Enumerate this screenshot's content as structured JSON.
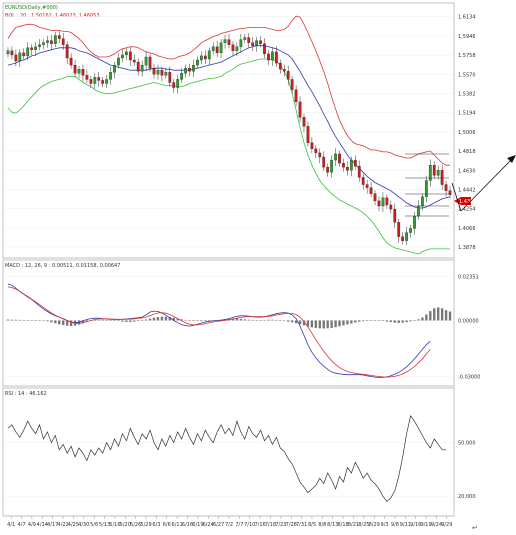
{
  "colors": {
    "up": "#2e9e2e",
    "down": "#d11c1c",
    "ma": "#2b3bb5",
    "band_upper": "#e03434",
    "band_lower": "#3ec03e",
    "macd_line": "#2b3bb5",
    "signal_line": "#e03434",
    "hist": "#777777",
    "rsi": "#333333",
    "price_tag_bg": "#e00000",
    "price_tag_text": "#ffffff",
    "grid": "#cccccc",
    "border": "#999999"
  },
  "header": {
    "title": "EURUSD(Daily,#000)",
    "bollinger": "BOL : 20 : 1.50162, 1.46023, 1.46053",
    "macd": "MACD : 12, 26, 9 : 0.00511, 0.01158, 0.00647",
    "rsi": "RSI : 14 : 46.162"
  },
  "price_tag": "1.4393",
  "chart_data": [
    {
      "type": "candlestick",
      "panel": "price",
      "title": "EURUSD(Daily,#000)",
      "indicator": "BOL : 20 : 1.50162, 1.46023, 1.46053",
      "y_ticks": [
        "1.6134",
        "1.5946",
        "1.5758",
        "1.5570",
        "1.5382",
        "1.5194",
        "1.5006",
        "1.4818",
        "1.4630",
        "1.4442",
        "1.4254",
        "1.4066",
        "1.3878"
      ],
      "ylim": [
        1.38,
        1.62
      ],
      "x_ticks": [
        "4/1",
        "4/7",
        "4/9",
        "4/14",
        "4/17",
        "4/22",
        "4/25",
        "4/30",
        "5/6",
        "5/13",
        "5/16",
        "5/20",
        "5/26",
        "5/29",
        "6/3",
        "6/6",
        "6/11",
        "6/16",
        "6/19",
        "6/24",
        "6/27",
        "7/2",
        "7/7",
        "7/10",
        "7/16",
        "7/18",
        "7/23",
        "7/28",
        "7/31",
        "8/5",
        "8/8",
        "8/13",
        "8/18",
        "8/21",
        "8/25",
        "8/29",
        "9/3",
        "9/8",
        "9/11",
        "9/16",
        "9/19",
        "9/24",
        "9/29"
      ],
      "close": [
        1.58,
        1.576,
        1.57,
        1.578,
        1.575,
        1.583,
        1.581,
        1.584,
        1.586,
        1.588,
        1.59,
        1.587,
        1.595,
        1.592,
        1.586,
        1.573,
        1.566,
        1.558,
        1.562,
        1.556,
        1.552,
        1.548,
        1.554,
        1.551,
        1.548,
        1.552,
        1.559,
        1.566,
        1.573,
        1.576,
        1.579,
        1.571,
        1.569,
        1.56,
        1.566,
        1.574,
        1.563,
        1.557,
        1.561,
        1.556,
        1.559,
        1.549,
        1.544,
        1.552,
        1.558,
        1.563,
        1.56,
        1.566,
        1.571,
        1.575,
        1.572,
        1.58,
        1.584,
        1.578,
        1.588,
        1.591,
        1.586,
        1.58,
        1.584,
        1.591,
        1.593,
        1.588,
        1.585,
        1.59,
        1.587,
        1.577,
        1.571,
        1.579,
        1.568,
        1.562,
        1.56,
        1.552,
        1.542,
        1.53,
        1.515,
        1.506,
        1.49,
        1.484,
        1.48,
        1.476,
        1.466,
        1.461,
        1.473,
        1.479,
        1.47,
        1.466,
        1.463,
        1.473,
        1.467,
        1.456,
        1.449,
        1.446,
        1.44,
        1.433,
        1.428,
        1.436,
        1.429,
        1.425,
        1.412,
        1.398,
        1.394,
        1.402,
        1.406,
        1.418,
        1.428,
        1.437,
        1.453,
        1.468,
        1.458,
        1.463,
        1.449,
        1.443,
        1.439
      ],
      "bb_upper": [
        1.592,
        1.598,
        1.603,
        1.604,
        1.605,
        1.606,
        1.606,
        1.605,
        1.603,
        1.602,
        1.601,
        1.6,
        1.6,
        1.6,
        1.599,
        1.599,
        1.598,
        1.595,
        1.592,
        1.588,
        1.583,
        1.579,
        1.576,
        1.574,
        1.574,
        1.574,
        1.575,
        1.577,
        1.58,
        1.582,
        1.583,
        1.584,
        1.584,
        1.583,
        1.581,
        1.579,
        1.578,
        1.577,
        1.575,
        1.574,
        1.573,
        1.572,
        1.572,
        1.574,
        1.575,
        1.576,
        1.578,
        1.581,
        1.584,
        1.588,
        1.59,
        1.592,
        1.594,
        1.595,
        1.597,
        1.598,
        1.599,
        1.6,
        1.601,
        1.602,
        1.602,
        1.603,
        1.603,
        1.603,
        1.603,
        1.603,
        1.602,
        1.601,
        1.6,
        1.6,
        1.601,
        1.604,
        1.61,
        1.614,
        1.613,
        1.606,
        1.598,
        1.589,
        1.58,
        1.57,
        1.56,
        1.548,
        1.535,
        1.523,
        1.512,
        1.504,
        1.497,
        1.492,
        1.489,
        1.488,
        1.487,
        1.485,
        1.483,
        1.483,
        1.482,
        1.481,
        1.481,
        1.48,
        1.478,
        1.477,
        1.476,
        1.475,
        1.475,
        1.477,
        1.479,
        1.48,
        1.481,
        1.482,
        1.478,
        1.474,
        1.47,
        1.468,
        1.468
      ],
      "bb_mid": [
        1.566,
        1.567,
        1.568,
        1.57,
        1.571,
        1.573,
        1.575,
        1.576,
        1.578,
        1.579,
        1.58,
        1.581,
        1.582,
        1.583,
        1.583,
        1.583,
        1.583,
        1.582,
        1.58,
        1.579,
        1.578,
        1.576,
        1.574,
        1.572,
        1.57,
        1.568,
        1.566,
        1.565,
        1.564,
        1.563,
        1.562,
        1.561,
        1.561,
        1.561,
        1.561,
        1.561,
        1.562,
        1.563,
        1.563,
        1.563,
        1.562,
        1.562,
        1.561,
        1.561,
        1.561,
        1.561,
        1.561,
        1.562,
        1.563,
        1.564,
        1.565,
        1.566,
        1.567,
        1.568,
        1.569,
        1.571,
        1.573,
        1.575,
        1.577,
        1.579,
        1.581,
        1.583,
        1.584,
        1.585,
        1.585,
        1.585,
        1.584,
        1.583,
        1.582,
        1.58,
        1.578,
        1.576,
        1.572,
        1.566,
        1.56,
        1.553,
        1.546,
        1.54,
        1.533,
        1.526,
        1.518,
        1.511,
        1.503,
        1.496,
        1.49,
        1.484,
        1.478,
        1.473,
        1.469,
        1.465,
        1.461,
        1.457,
        1.454,
        1.451,
        1.449,
        1.447,
        1.445,
        1.443,
        1.44,
        1.437,
        1.434,
        1.431,
        1.429,
        1.427,
        1.426,
        1.426,
        1.427,
        1.429,
        1.431,
        1.433,
        1.435,
        1.436,
        1.437
      ],
      "bb_lower": [
        1.524,
        1.52,
        1.519,
        1.522,
        1.526,
        1.531,
        1.535,
        1.539,
        1.543,
        1.546,
        1.548,
        1.55,
        1.551,
        1.552,
        1.553,
        1.555,
        1.555,
        1.555,
        1.552,
        1.549,
        1.547,
        1.545,
        1.542,
        1.54,
        1.539,
        1.538,
        1.538,
        1.539,
        1.54,
        1.541,
        1.542,
        1.543,
        1.544,
        1.545,
        1.546,
        1.547,
        1.548,
        1.549,
        1.548,
        1.547,
        1.546,
        1.546,
        1.546,
        1.545,
        1.545,
        1.546,
        1.548,
        1.549,
        1.55,
        1.551,
        1.552,
        1.553,
        1.553,
        1.554,
        1.555,
        1.558,
        1.56,
        1.562,
        1.565,
        1.567,
        1.568,
        1.569,
        1.57,
        1.571,
        1.572,
        1.572,
        1.572,
        1.571,
        1.57,
        1.566,
        1.56,
        1.552,
        1.538,
        1.522,
        1.505,
        1.49,
        1.478,
        1.468,
        1.46,
        1.453,
        1.448,
        1.444,
        1.44,
        1.437,
        1.434,
        1.432,
        1.43,
        1.428,
        1.426,
        1.424,
        1.421,
        1.418,
        1.414,
        1.409,
        1.403,
        1.397,
        1.392,
        1.389,
        1.387,
        1.386,
        1.385,
        1.384,
        1.383,
        1.382,
        1.381,
        1.383,
        1.385,
        1.386,
        1.386,
        1.386,
        1.386,
        1.386,
        1.386
      ]
    },
    {
      "type": "bar-line",
      "panel": "macd",
      "title": "MACD : 12, 26, 9 : 0.00511, 0.01158, 0.00647",
      "y_ticks": [
        "0.02351",
        "0.00000",
        "-0.03000"
      ],
      "ylim": [
        -0.034,
        0.027
      ],
      "hist": [
        0.0005,
        0.0004,
        0.0004,
        0.0003,
        0.0003,
        0.0002,
        0.0002,
        0.0001,
        0.0001,
        0.0,
        -0.0005,
        -0.001,
        -0.0015,
        -0.002,
        -0.0025,
        -0.0028,
        -0.003,
        -0.0028,
        -0.0022,
        -0.0015,
        -0.0008,
        -0.0003,
        0.0001,
        0.0003,
        0.0004,
        0.0003,
        0.0002,
        0.0,
        -0.0003,
        -0.0006,
        -0.0008,
        -0.0008,
        -0.0006,
        -0.0003,
        0.0001,
        0.0005,
        0.001,
        0.0015,
        0.0018,
        0.002,
        0.002,
        0.0018,
        0.0015,
        0.001,
        0.0006,
        0.0003,
        0.0001,
        -0.0001,
        -0.0003,
        -0.0004,
        -0.0004,
        -0.0003,
        -0.0001,
        0.0001,
        0.0004,
        0.0007,
        0.0009,
        0.001,
        0.001,
        0.0008,
        0.0006,
        0.0004,
        0.0003,
        0.0002,
        0.0002,
        0.0003,
        0.0004,
        0.0004,
        0.0003,
        0.0001,
        -0.0002,
        -0.0006,
        -0.001,
        -0.0015,
        -0.002,
        -0.0026,
        -0.0032,
        -0.0037,
        -0.004,
        -0.0042,
        -0.0043,
        -0.0042,
        -0.004,
        -0.0036,
        -0.0031,
        -0.0026,
        -0.0021,
        -0.0016,
        -0.0011,
        -0.0007,
        -0.0004,
        -0.0002,
        -0.0001,
        0.0,
        -0.0001,
        -0.0003,
        -0.0006,
        -0.0009,
        -0.0012,
        -0.0013,
        -0.0012,
        -0.0009,
        -0.0005,
        0.0,
        0.0006,
        0.0016,
        0.0032,
        0.005,
        0.0065,
        0.007,
        0.0065,
        0.0055,
        0.0048
      ],
      "macd_line": [
        0.0195,
        0.0188,
        0.0172,
        0.0155,
        0.014,
        0.0125,
        0.0112,
        0.0095,
        0.0078,
        0.0062,
        0.0048,
        0.0035,
        0.0025,
        0.0018,
        0.001,
        0.0,
        -0.0008,
        -0.0012,
        -0.001,
        -0.0002,
        0.0005,
        0.001,
        0.0012,
        0.0012,
        0.001,
        0.0008,
        0.0006,
        0.0005,
        0.0005,
        0.0006,
        0.0008,
        0.001,
        0.0012,
        0.0014,
        0.0018,
        0.003,
        0.0045,
        0.005,
        0.0048,
        0.004,
        0.0028,
        0.0015,
        0.0,
        -0.0012,
        -0.0022,
        -0.0028,
        -0.003,
        -0.0026,
        -0.002,
        -0.0014,
        -0.0008,
        -0.0004,
        -0.0002,
        0.0,
        0.0002,
        0.0005,
        0.001,
        0.0016,
        0.0022,
        0.0025,
        0.0025,
        0.0023,
        0.002,
        0.0018,
        0.0018,
        0.002,
        0.0025,
        0.003,
        0.0036,
        0.004,
        0.0042,
        0.004,
        0.003,
        0.001,
        -0.003,
        -0.008,
        -0.013,
        -0.017,
        -0.02,
        -0.0225,
        -0.0245,
        -0.0262,
        -0.0275,
        -0.0282,
        -0.0286,
        -0.0288,
        -0.029,
        -0.029,
        -0.029,
        -0.029,
        -0.0292,
        -0.0296,
        -0.03,
        -0.0303,
        -0.0305,
        -0.0305,
        -0.0302,
        -0.0296,
        -0.0288,
        -0.0278,
        -0.0264,
        -0.0248,
        -0.0228,
        -0.0205,
        -0.018,
        -0.0155,
        -0.013,
        -0.011
      ],
      "signal_line": [
        0.018,
        0.0176,
        0.0168,
        0.0156,
        0.0142,
        0.0128,
        0.0114,
        0.01,
        0.0086,
        0.007,
        0.0055,
        0.004,
        0.0028,
        0.0018,
        0.0008,
        -0.0002,
        -0.001,
        -0.0015,
        -0.0016,
        -0.0012,
        -0.0006,
        0.0,
        0.0005,
        0.0008,
        0.0009,
        0.0009,
        0.0008,
        0.0007,
        0.0006,
        0.0006,
        0.0006,
        0.0007,
        0.0009,
        0.0011,
        0.0013,
        0.0018,
        0.0026,
        0.0034,
        0.004,
        0.0042,
        0.0039,
        0.0032,
        0.0022,
        0.001,
        -0.0002,
        -0.0012,
        -0.002,
        -0.0024,
        -0.0024,
        -0.0021,
        -0.0017,
        -0.0012,
        -0.0008,
        -0.0005,
        -0.0002,
        0.0001,
        0.0004,
        0.0008,
        0.0012,
        0.0016,
        0.0019,
        0.0021,
        0.0021,
        0.0021,
        0.0021,
        0.0021,
        0.0022,
        0.0025,
        0.0029,
        0.0033,
        0.0036,
        0.0038,
        0.0038,
        0.0032,
        0.0018,
        -0.0005,
        -0.0035,
        -0.0068,
        -0.0102,
        -0.0135,
        -0.0165,
        -0.0192,
        -0.0216,
        -0.0236,
        -0.0252,
        -0.0264,
        -0.0273,
        -0.0279,
        -0.0283,
        -0.0286,
        -0.0288,
        -0.0291,
        -0.0294,
        -0.0297,
        -0.03,
        -0.0302,
        -0.0303,
        -0.0302,
        -0.0299,
        -0.0294,
        -0.0286,
        -0.0276,
        -0.0262,
        -0.0246,
        -0.0226,
        -0.0205,
        -0.018,
        -0.0155
      ]
    },
    {
      "type": "line",
      "panel": "rsi",
      "title": "RSI : 14 : 46.162",
      "y_ticks": [
        "50.000",
        "20.000"
      ],
      "ylim": [
        10,
        75
      ],
      "values": [
        58,
        60,
        56,
        53,
        57,
        62,
        58,
        55,
        60,
        52,
        56,
        50,
        54,
        46,
        49,
        44,
        48,
        42,
        47,
        44,
        40,
        46,
        43,
        47,
        44,
        50,
        46,
        52,
        48,
        55,
        51,
        58,
        53,
        49,
        55,
        52,
        57,
        50,
        46,
        52,
        48,
        54,
        50,
        56,
        52,
        58,
        53,
        49,
        55,
        51,
        57,
        53,
        50,
        56,
        60,
        55,
        58,
        54,
        62,
        56,
        52,
        59,
        55,
        53,
        57,
        51,
        54,
        49,
        53,
        47,
        45,
        41,
        38,
        33,
        28,
        25,
        22,
        24,
        26,
        30,
        27,
        33,
        29,
        24,
        31,
        28,
        36,
        33,
        39,
        35,
        30,
        33,
        29,
        27,
        24,
        20,
        17,
        19,
        23,
        31,
        42,
        55,
        65,
        62,
        58,
        54,
        50,
        47,
        52,
        49,
        46,
        46
      ]
    }
  ]
}
